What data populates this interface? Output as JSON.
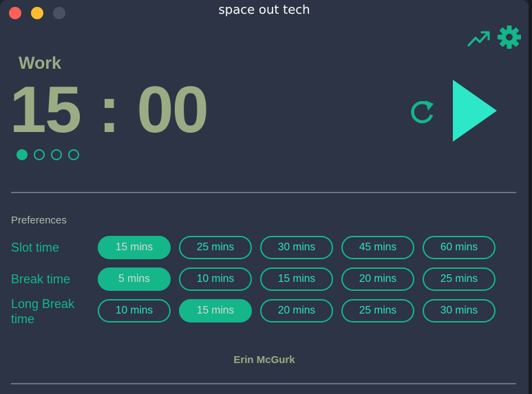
{
  "window": {
    "title": "space out tech"
  },
  "timer": {
    "mode": "Work",
    "minutes": "15",
    "separator": ":",
    "seconds": "00",
    "session_dots": [
      true,
      false,
      false,
      false
    ]
  },
  "icons": {
    "stats": "trending-up-icon",
    "settings": "gear-icon",
    "reset": "refresh-icon",
    "play": "play-icon"
  },
  "preferences": {
    "title": "Preferences",
    "rows": [
      {
        "label": "Slot time",
        "options": [
          "15 mins",
          "25 mins",
          "30 mins",
          "45 mins",
          "60 mins"
        ],
        "selected": 0
      },
      {
        "label": "Break time",
        "options": [
          "5 mins",
          "10 mins",
          "15 mins",
          "20 mins",
          "25 mins"
        ],
        "selected": 0
      },
      {
        "label": "Long Break time",
        "options": [
          "10 mins",
          "15 mins",
          "20 mins",
          "25 mins",
          "30 mins"
        ],
        "selected": 1
      }
    ]
  },
  "footer": {
    "author": "Erin McGurk"
  },
  "colors": {
    "background": "#2c3445",
    "accent": "#14b68a",
    "play": "#2de8c8",
    "text_muted": "#9aac84"
  }
}
